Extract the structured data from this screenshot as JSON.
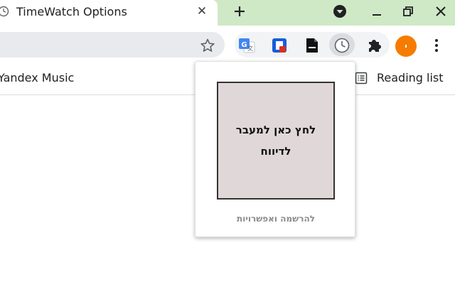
{
  "tab": {
    "title": "TimeWatch Options",
    "favicon": "clock-icon",
    "close_icon": "close-icon"
  },
  "tabstrip": {
    "background": "#cfe9c6",
    "new_tab_icon": "plus-icon",
    "controls": [
      "media-control-icon",
      "minimize-icon",
      "restore-icon",
      "close-window-icon"
    ]
  },
  "toolbar": {
    "star_icon": "star-icon",
    "extensions": [
      "google-translate-icon",
      "bitwarden-icon",
      "pdf-document-icon",
      "timewatch-clock-icon",
      "puzzle-extensions-icon"
    ],
    "avatar_color": "#f57c00",
    "menu_icon": "kebab-menu-icon"
  },
  "bookmarks": {
    "items": [
      "Yandex Music"
    ],
    "reading_list": "Reading list"
  },
  "popup": {
    "report_button": "לחץ כאן למעבר לדיווח",
    "register_link": "להרשמה ואפשרויות"
  }
}
